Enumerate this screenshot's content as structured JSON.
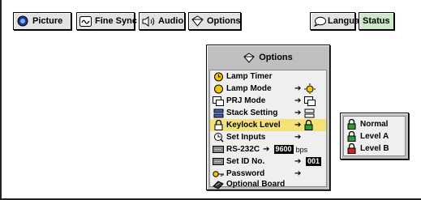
{
  "toolbar": {
    "tabs": [
      {
        "label": "Picture",
        "icon": "picture-icon"
      },
      {
        "label": "Fine Sync",
        "icon": "fine-sync-icon"
      },
      {
        "label": "Audio",
        "icon": "speaker-icon"
      },
      {
        "label": "Options",
        "icon": "options-icon"
      }
    ],
    "language": {
      "label": "Language",
      "icon": "speech-bubble-icon"
    },
    "status": {
      "label": "Status"
    }
  },
  "options_menu": {
    "title": "Options",
    "items": [
      {
        "label": "Lamp Timer",
        "icon": "lamp-timer-icon",
        "arrow": "",
        "selected": false
      },
      {
        "label": "Lamp Mode",
        "icon": "lamp-mode-icon",
        "arrow": "➔",
        "selected": false
      },
      {
        "label": "PRJ Mode",
        "icon": "prj-mode-icon",
        "arrow": "➔",
        "selected": false
      },
      {
        "label": "Stack Setting",
        "icon": "stack-setting-icon",
        "arrow": "➔",
        "selected": false
      },
      {
        "label": "Keylock Level",
        "icon": "lock-icon",
        "arrow": "➔",
        "selected": true
      },
      {
        "label": "Set Inputs",
        "icon": "set-inputs-icon",
        "arrow": "➔",
        "selected": false
      },
      {
        "label": "RS-232C",
        "icon": "rs232c-icon",
        "arrow": "➔",
        "value": "9600",
        "unit": "bps",
        "selected": false
      },
      {
        "label": "Set ID No.",
        "icon": "set-id-icon",
        "arrow": "➔",
        "value": "001",
        "selected": false
      },
      {
        "label": "Password",
        "icon": "key-icon",
        "arrow": "➔",
        "selected": false
      },
      {
        "label": "Optional Board",
        "icon": "board-icon",
        "arrow": "",
        "selected": false
      }
    ]
  },
  "keylock_submenu": {
    "items": [
      {
        "label": "Normal",
        "icon": "lock-green-icon",
        "color": "#2e9a3a"
      },
      {
        "label": "Level A",
        "icon": "lock-green-icon",
        "color": "#2e9a3a"
      },
      {
        "label": "Level B",
        "icon": "lock-red-icon",
        "color": "#d12020"
      }
    ]
  },
  "colors": {
    "status_bg": "#cde9c9",
    "selected_row": "#f4e178",
    "panel": "#bfbfbf"
  }
}
